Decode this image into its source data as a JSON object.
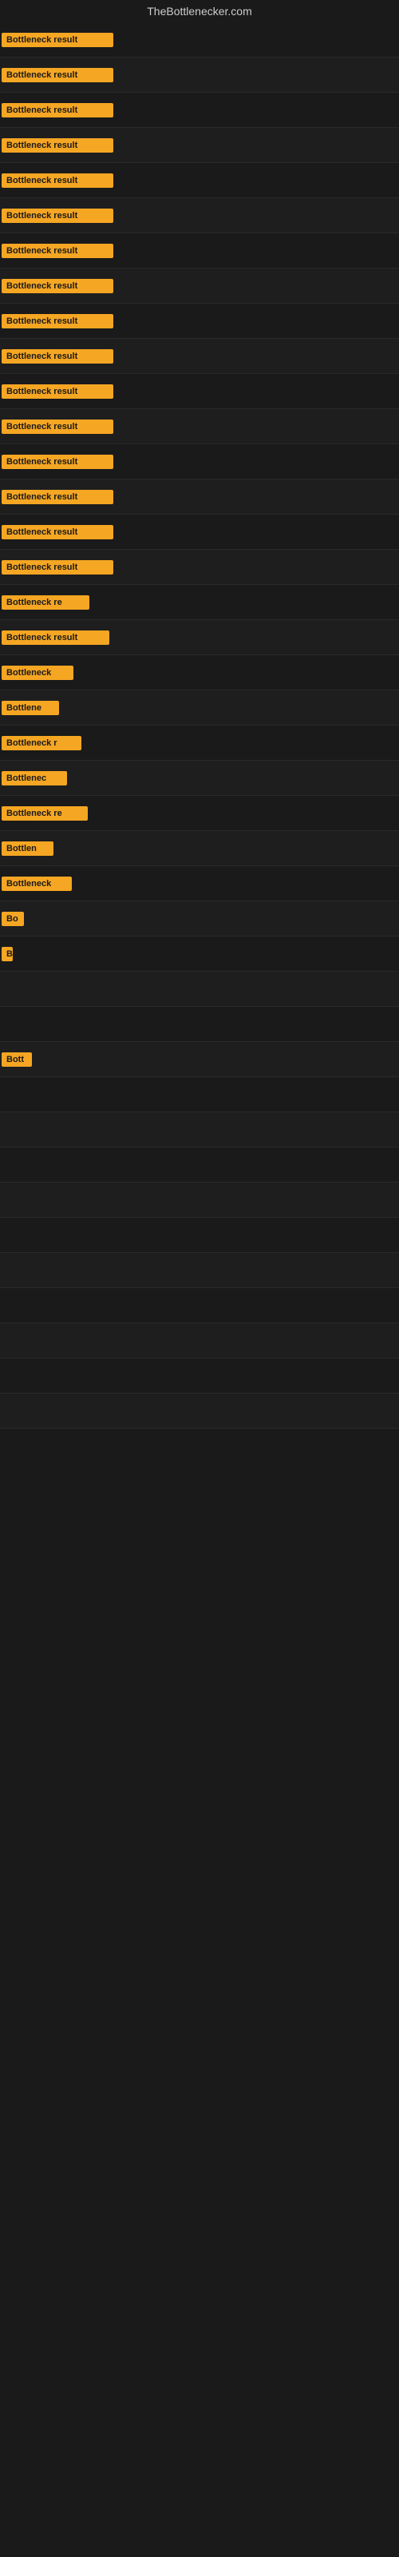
{
  "site": {
    "title": "TheBottlenecker.com"
  },
  "results": [
    {
      "label": "Bottleneck result",
      "width": 140
    },
    {
      "label": "Bottleneck result",
      "width": 140
    },
    {
      "label": "Bottleneck result",
      "width": 140
    },
    {
      "label": "Bottleneck result",
      "width": 140
    },
    {
      "label": "Bottleneck result",
      "width": 140
    },
    {
      "label": "Bottleneck result",
      "width": 140
    },
    {
      "label": "Bottleneck result",
      "width": 140
    },
    {
      "label": "Bottleneck result",
      "width": 140
    },
    {
      "label": "Bottleneck result",
      "width": 140
    },
    {
      "label": "Bottleneck result",
      "width": 140
    },
    {
      "label": "Bottleneck result",
      "width": 140
    },
    {
      "label": "Bottleneck result",
      "width": 140
    },
    {
      "label": "Bottleneck result",
      "width": 140
    },
    {
      "label": "Bottleneck result",
      "width": 140
    },
    {
      "label": "Bottleneck result",
      "width": 140
    },
    {
      "label": "Bottleneck result",
      "width": 140
    },
    {
      "label": "Bottleneck re",
      "width": 110
    },
    {
      "label": "Bottleneck result",
      "width": 135
    },
    {
      "label": "Bottleneck",
      "width": 90
    },
    {
      "label": "Bottlene",
      "width": 72
    },
    {
      "label": "Bottleneck r",
      "width": 100
    },
    {
      "label": "Bottlenec",
      "width": 82
    },
    {
      "label": "Bottleneck re",
      "width": 108
    },
    {
      "label": "Bottlen",
      "width": 65
    },
    {
      "label": "Bottleneck",
      "width": 88
    },
    {
      "label": "Bo",
      "width": 28
    },
    {
      "label": "B",
      "width": 14
    },
    {
      "label": "",
      "width": 0
    },
    {
      "label": "",
      "width": 6
    },
    {
      "label": "Bott",
      "width": 38
    },
    {
      "label": "",
      "width": 0
    },
    {
      "label": "",
      "width": 0
    },
    {
      "label": "",
      "width": 0
    },
    {
      "label": "",
      "width": 0
    },
    {
      "label": "",
      "width": 0
    },
    {
      "label": "",
      "width": 0
    },
    {
      "label": "",
      "width": 0
    },
    {
      "label": "",
      "width": 0
    },
    {
      "label": "",
      "width": 0
    },
    {
      "label": "",
      "width": 0
    }
  ],
  "accent_color": "#f5a623"
}
